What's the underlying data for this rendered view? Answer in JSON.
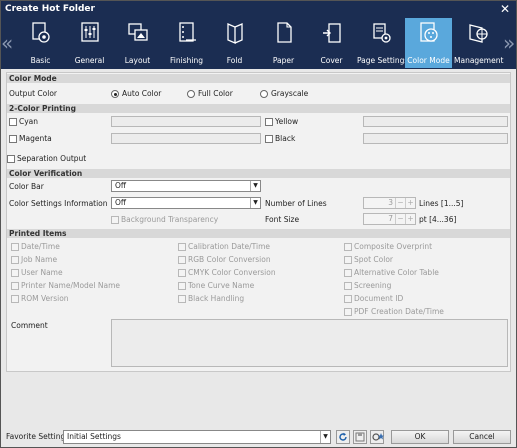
{
  "window": {
    "title": "Create Hot Folder"
  },
  "toolbar": {
    "tabs": [
      {
        "label": "Basic",
        "icon": "basic-gear-icon"
      },
      {
        "label": "General",
        "icon": "general-sliders-icon"
      },
      {
        "label": "Layout",
        "icon": "layout-icon"
      },
      {
        "label": "Finishing",
        "icon": "finishing-icon"
      },
      {
        "label": "Fold",
        "icon": "fold-icon"
      },
      {
        "label": "Paper",
        "icon": "paper-icon"
      },
      {
        "label": "Cover",
        "icon": "cover-icon"
      },
      {
        "label": "Page Settings",
        "icon": "page-settings-icon"
      },
      {
        "label": "Color Mode",
        "icon": "color-mode-icon",
        "active": true
      },
      {
        "label": "Management",
        "icon": "management-icon"
      }
    ],
    "active_color": "#5aa8dc",
    "bg_color": "#1b2d52"
  },
  "color_mode": {
    "header": "Color Mode",
    "output_color_label": "Output Color",
    "options": [
      "Auto Color",
      "Full Color",
      "Grayscale"
    ],
    "selected": "Auto Color"
  },
  "two_color": {
    "header": "2-Color Printing",
    "cyan": "Cyan",
    "yellow": "Yellow",
    "magenta": "Magenta",
    "black": "Black"
  },
  "separation_output": "Separation Output",
  "verification": {
    "header": "Color Verification",
    "color_bar_label": "Color Bar",
    "color_bar_value": "Off",
    "color_settings_label": "Color Settings Information",
    "color_settings_value": "Off",
    "background_transparency": "Background Transparency",
    "number_of_lines_label": "Number of Lines",
    "number_of_lines_value": "3",
    "lines_range": "Lines [1...5]",
    "font_size_label": "Font Size",
    "font_size_value": "7",
    "font_range": "pt [4...36]"
  },
  "printed_items": {
    "header": "Printed Items",
    "col1": [
      "Date/Time",
      "Job Name",
      "User Name",
      "Printer Name/Model Name",
      "ROM Version"
    ],
    "col2": [
      "Calibration Date/Time",
      "RGB Color Conversion",
      "CMYK Color Conversion",
      "Tone Curve Name",
      "Black Handling"
    ],
    "col3": [
      "Composite Overprint",
      "Spot Color",
      "Alternative Color Table",
      "Screening",
      "Document ID",
      "PDF Creation Date/Time"
    ],
    "comment_label": "Comment"
  },
  "footer": {
    "favorite_label": "Favorite Setting",
    "favorite_value": "Initial Settings",
    "ok_label": "OK",
    "cancel_label": "Cancel"
  }
}
